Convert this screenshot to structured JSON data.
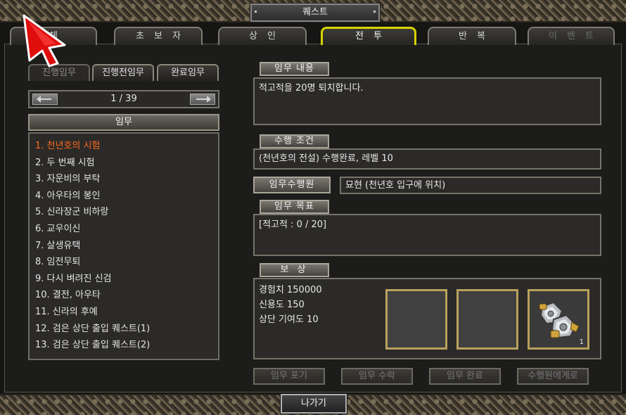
{
  "window": {
    "title": "퀘스트"
  },
  "tabs": [
    {
      "label": "전체",
      "display": "체",
      "state": "normal"
    },
    {
      "label": "초보자",
      "state": "normal"
    },
    {
      "label": "상인",
      "state": "normal"
    },
    {
      "label": "전투",
      "state": "active"
    },
    {
      "label": "반복",
      "state": "normal"
    },
    {
      "label": "이벤트",
      "state": "disabled"
    }
  ],
  "subtabs": [
    "진행임무",
    "진행전임무",
    "완료임무"
  ],
  "pager": {
    "text": "1 / 39"
  },
  "quest_list": {
    "header": "임무",
    "items": [
      "1. 천년호의 시험",
      "2. 두 번째 시험",
      "3. 자운비의 부탁",
      "4. 아우타의 봉인",
      "5. 신라장군 비하랑",
      "6. 교우이신",
      "7. 살생유택",
      "8. 임전무퇴",
      "9. 다시 벼려진 신검",
      "10. 결전, 아우타",
      "11. 신라의 후예",
      "12. 검은 상단 출입 퀘스트(1)",
      "13. 검은 상단 출입 퀘스트(2)"
    ],
    "selected_index": 0
  },
  "detail": {
    "content_label": "임무 내용",
    "content_text": "적고적을 20명 퇴치합니다.",
    "condition_label": "수행 조건",
    "condition_text": "(천년호의 전설) 수행완료, 레벨 10",
    "giver_label": "임무수행원",
    "giver_text": "묘현 (천년호 입구에 위치)",
    "goal_label": "임무 목표",
    "goal_text": "[적고적 : 0 / 20]",
    "reward_label": "보 상",
    "rewards": [
      "경험치 150000",
      "신용도 150",
      "상단 기여도 10"
    ],
    "reward_item_count": "1"
  },
  "buttons": [
    "임무 포기",
    "임무 수락",
    "임무 완료",
    "수행원에게로"
  ],
  "exit_button": "나가기",
  "colors": {
    "active_tab_border": "#d8d200",
    "selected_quest": "#ff6a1e"
  },
  "icons": [
    "arrow-left-icon",
    "arrow-right-icon",
    "gauntlet-icon",
    "mouse-cursor-icon"
  ]
}
